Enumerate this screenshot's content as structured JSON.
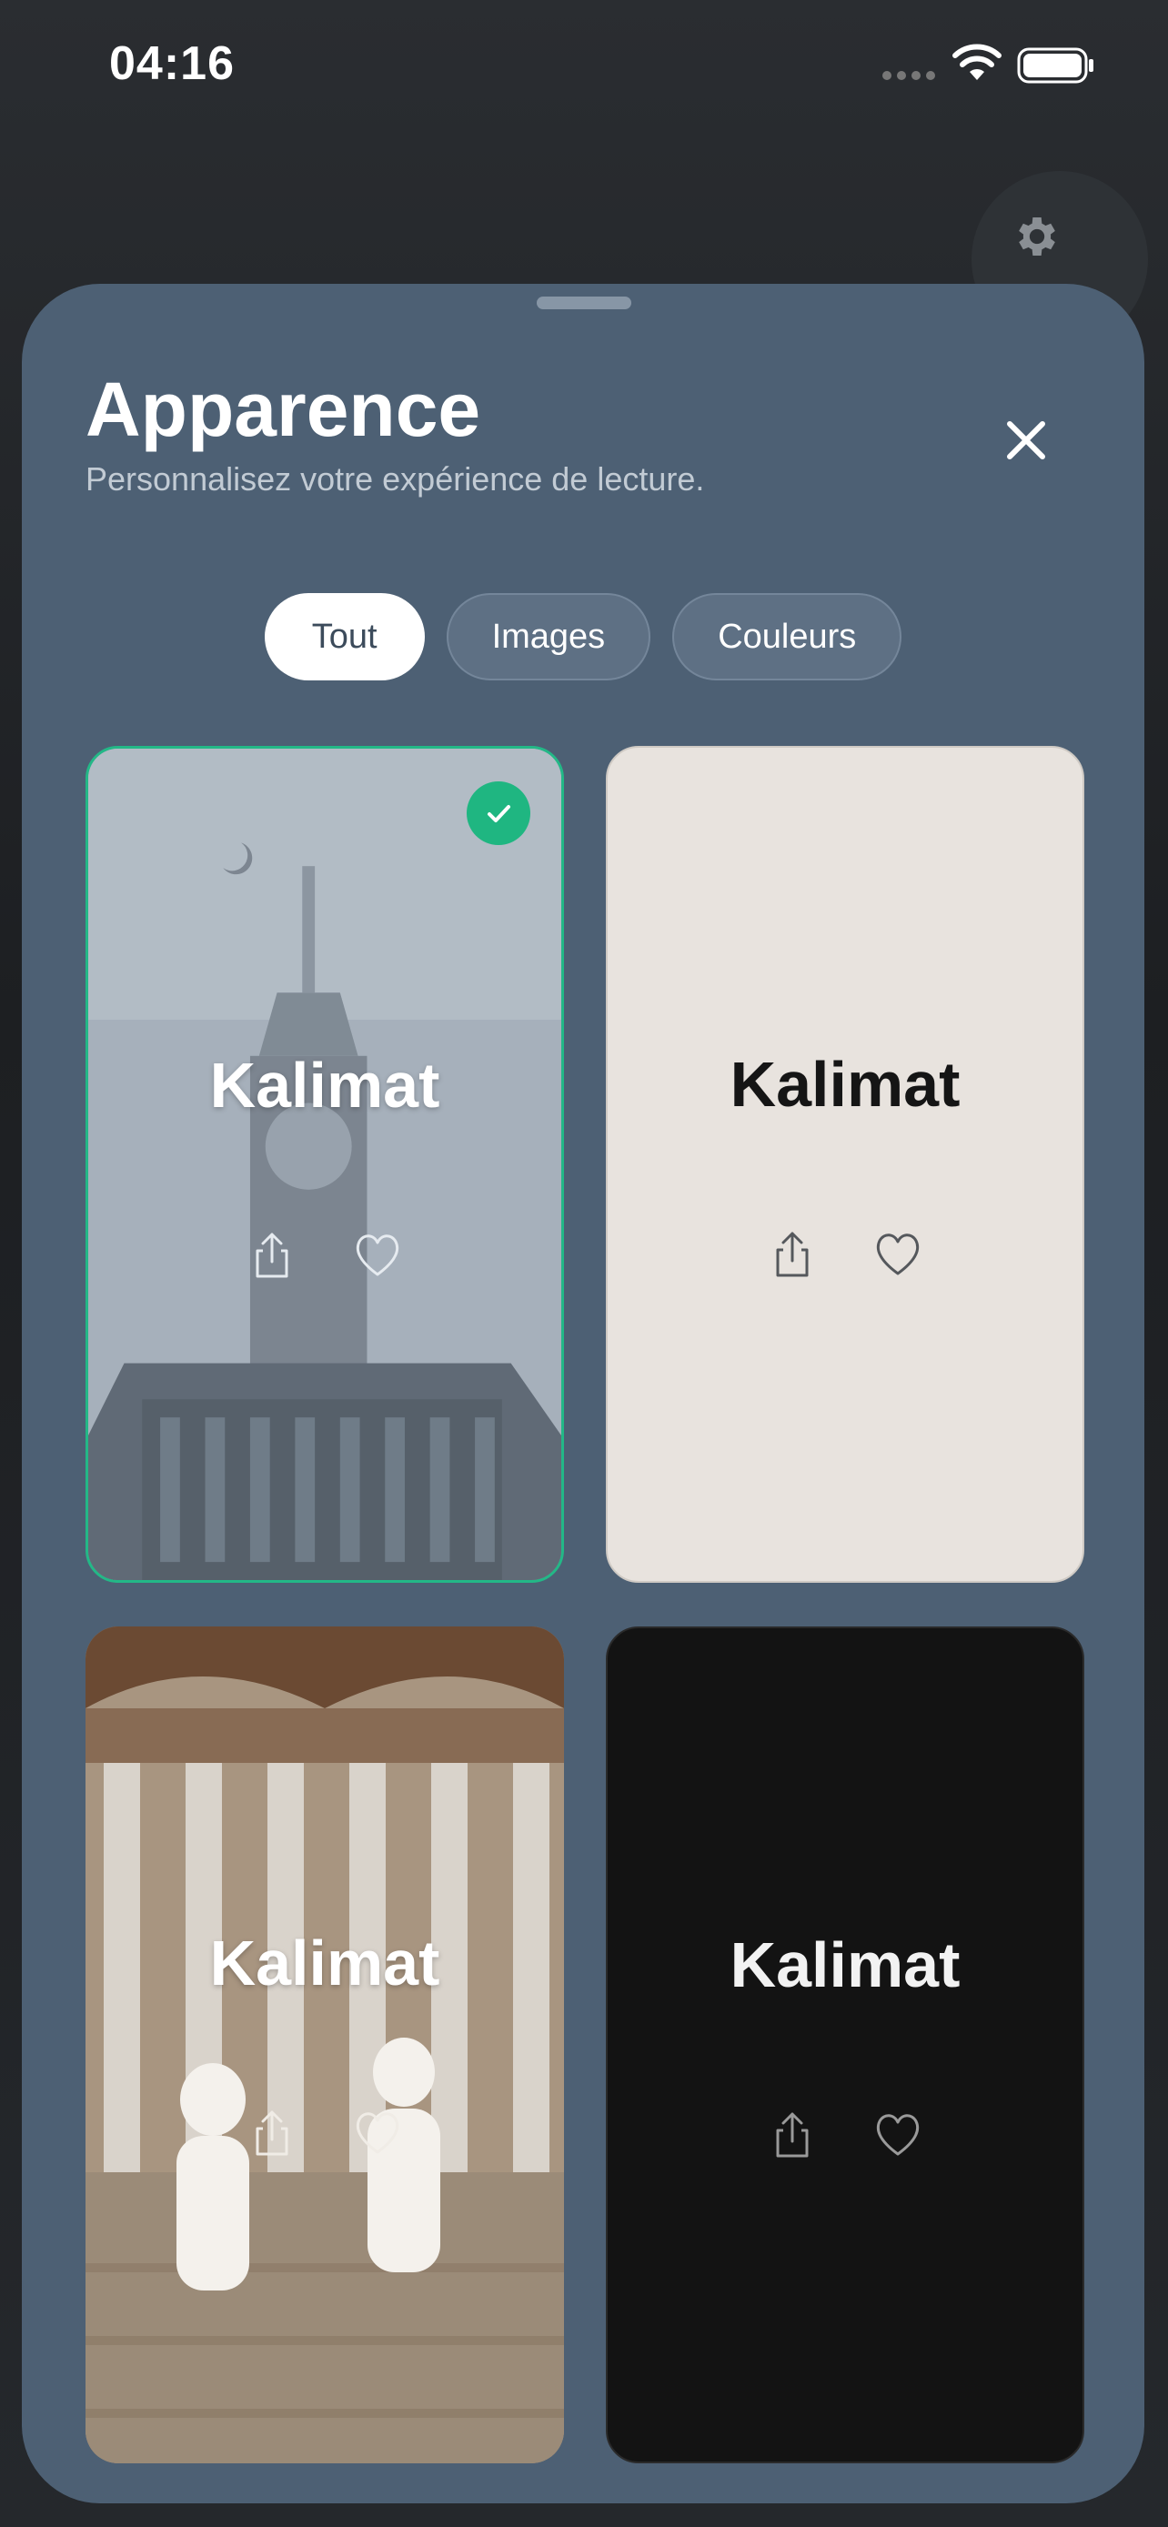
{
  "status_bar": {
    "time": "04:16",
    "icons": [
      "signal-icon",
      "wifi-icon",
      "battery-icon"
    ]
  },
  "settings_button": {
    "icon": "gear-icon"
  },
  "sheet": {
    "title": "Apparence",
    "subtitle": "Personnalisez votre expérience de lecture.",
    "close_icon": "close-icon"
  },
  "tabs": [
    {
      "label": "Tout",
      "active": true
    },
    {
      "label": "Images",
      "active": false
    },
    {
      "label": "Couleurs",
      "active": false
    }
  ],
  "cards": [
    {
      "label": "Kalimat",
      "theme": "image-clock-tower",
      "selected": true
    },
    {
      "label": "Kalimat",
      "theme": "color-cream",
      "color": "#e8e3de",
      "selected": false
    },
    {
      "label": "Kalimat",
      "theme": "image-mosque-children",
      "selected": false
    },
    {
      "label": "Kalimat",
      "theme": "color-black",
      "color": "#131313",
      "selected": false
    }
  ],
  "colors": {
    "sheet_background": "#4d6074",
    "accent_selected": "#1fb681",
    "tab_active_bg": "#ffffff"
  }
}
